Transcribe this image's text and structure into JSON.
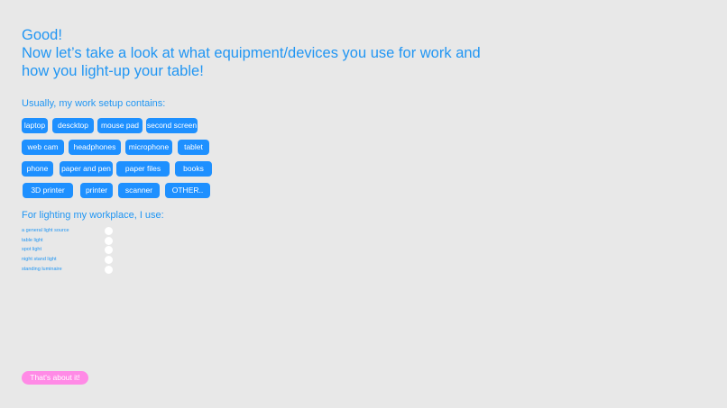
{
  "intro": {
    "line1": "Good!",
    "line2": "Now let’s take a look at what equipment/devices you use for work and",
    "line3": "how you light-up your table!"
  },
  "setup": {
    "title": "Usually, my work setup contains:",
    "rows": [
      [
        "laptop",
        "descktop",
        "mouse pad",
        "second screen"
      ],
      [
        "web cam",
        "headphones",
        "microphone",
        "tablet"
      ],
      [
        "phone",
        "paper and pen",
        "paper files",
        "books"
      ],
      [
        "3D printer",
        "printer",
        "scanner",
        "OTHER.."
      ]
    ]
  },
  "lighting": {
    "title": "For lighting my workplace, I use:",
    "options": [
      "a general light source",
      "table light",
      "spot light",
      "night stand light",
      "standing luminaire"
    ]
  },
  "footer": {
    "done_label": "That's about it!"
  },
  "colors": {
    "accent": "#2196f3",
    "chip": "#1e90ff",
    "done_button": "#ff8ae6",
    "background": "#e8e8e8"
  }
}
